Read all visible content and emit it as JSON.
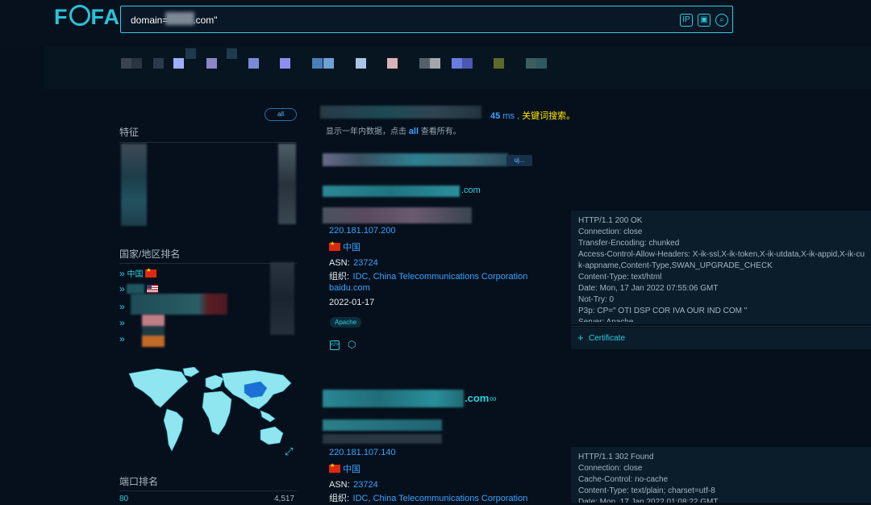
{
  "header": {
    "logo": "FOFA",
    "search_value": "domain=\"        .com\""
  },
  "stats": {
    "time": "45",
    "unit": "ms ,",
    "keyword_link": "关键词搜索。",
    "note_prefix": "显示一年内数据，点击",
    "note_all": "all",
    "note_suffix": "查看所有。",
    "all_tag": "all"
  },
  "sidebar": {
    "features_title": "特征",
    "country_title": "国家/地区排名",
    "countries": [
      {
        "name": "中国",
        "flag": "cn"
      },
      {
        "name": "",
        "flag": "us"
      },
      {
        "name": "",
        "flag": ""
      },
      {
        "name": "",
        "flag": ""
      },
      {
        "name": "",
        "flag": ""
      }
    ],
    "port_title": "端口排名",
    "ports": [
      {
        "port": "80",
        "count": "4,517"
      }
    ]
  },
  "results": [
    {
      "domain_suffix": ".com",
      "ip": "220.181.107.200",
      "country": "中国",
      "asn_label": "ASN:",
      "asn": "23724",
      "org_label": "组织:",
      "org": "IDC, China Telecommunications Corporation",
      "host": "baidu.com",
      "date": "2022-01-17",
      "tag": "Apache",
      "chip": "uj...",
      "header_text": "HTTP/1.1 200 OK\nConnection: close\nTransfer-Encoding: chunked\nAccess-Control-Allow-Headers: X-ik-ssl,X-ik-token,X-ik-utdata,X-ik-appid,X-ik-cu\nk-appname,Content-Type,SWAN_UPGRADE_CHECK\nContent-Type: text/html\nDate: Mon, 17 Jan 2022 07:55:06 GMT\nNot-Try: 0\nP3p: CP=\" OTI DSP COR IVA OUR IND COM \"\nServer: Apache",
      "certificate": "Certificate"
    },
    {
      "domain_suffix": ".com",
      "ip": "220.181.107.140",
      "country": "中国",
      "asn_label": "ASN:",
      "asn": "23724",
      "org_label": "组织:",
      "org": "IDC, China Telecommunications Corporation",
      "header_text": "HTTP/1.1 302 Found\nConnection: close\nCache-Control: no-cache\nContent-Type: text/plain; charset=utf-8\nDate: Mon, 17 Jan 2022 01:08:22 GMT"
    }
  ],
  "colors": {
    "accent": "#2ad0e0",
    "link": "#3aa3ff",
    "highlight": "#ffe600",
    "bg": "#06101c"
  }
}
